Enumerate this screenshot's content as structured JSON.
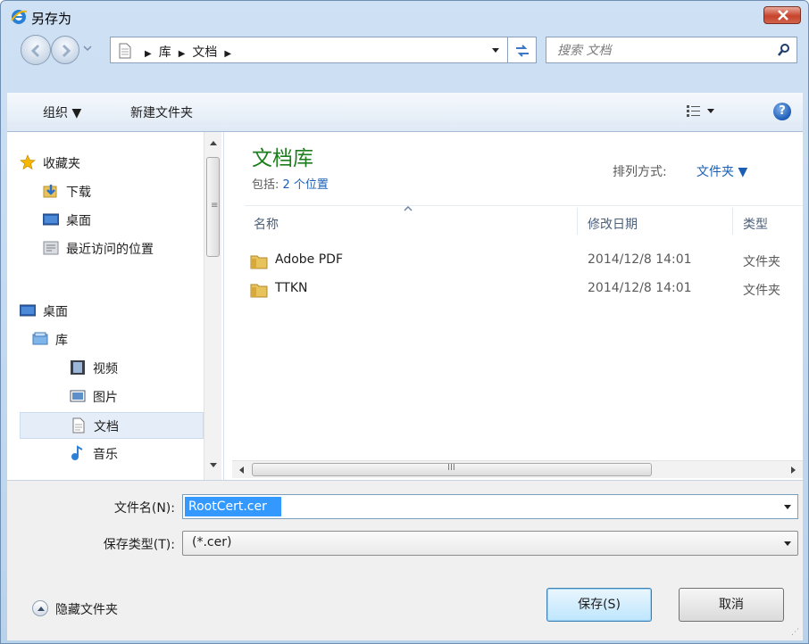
{
  "window": {
    "title": "另存为",
    "title_icon": "ie-icon",
    "close_icon": "close-icon"
  },
  "nav": {
    "breadcrumb": [
      "库",
      "文档"
    ],
    "search_placeholder": "搜索 文档"
  },
  "toolbar": {
    "organize_label": "组织 ▼",
    "new_folder_label": "新建文件夹",
    "help_label": "?"
  },
  "sidebar": {
    "items": [
      {
        "label": "收藏夹",
        "icon": "star-icon"
      },
      {
        "label": "下载",
        "icon": "download-folder-icon"
      },
      {
        "label": "桌面",
        "icon": "desktop-icon"
      },
      {
        "label": "最近访问的位置",
        "icon": "recent-places-icon"
      },
      {
        "label": "桌面",
        "icon": "desktop-icon"
      },
      {
        "label": "库",
        "icon": "library-icon"
      },
      {
        "label": "视频",
        "icon": "video-icon"
      },
      {
        "label": "图片",
        "icon": "pictures-icon"
      },
      {
        "label": "文档",
        "icon": "documents-icon"
      },
      {
        "label": "音乐",
        "icon": "music-icon"
      }
    ]
  },
  "library": {
    "title": "文档库",
    "includes_label": "包括:",
    "includes_link": "2 个位置",
    "arrange_label": "排列方式:",
    "arrange_value": "文件夹 ▼"
  },
  "columns": {
    "name": "名称",
    "date": "修改日期",
    "type": "类型"
  },
  "files": [
    {
      "name": "Adobe PDF",
      "date": "2014/12/8 14:01",
      "type": "文件夹"
    },
    {
      "name": "TTKN",
      "date": "2014/12/8 14:01",
      "type": "文件夹"
    }
  ],
  "form": {
    "filename_label": "文件名(N):",
    "filename_value": "RootCert.cer",
    "filetype_label": "保存类型(T):",
    "filetype_value": "(*.cer)",
    "hide_folders_label": "隐藏文件夹",
    "save_label": "保存(S)",
    "cancel_label": "取消"
  },
  "colors": {
    "accent": "#1a5fb4",
    "library_title": "#1e7d1e",
    "selection": "#3399ff"
  }
}
